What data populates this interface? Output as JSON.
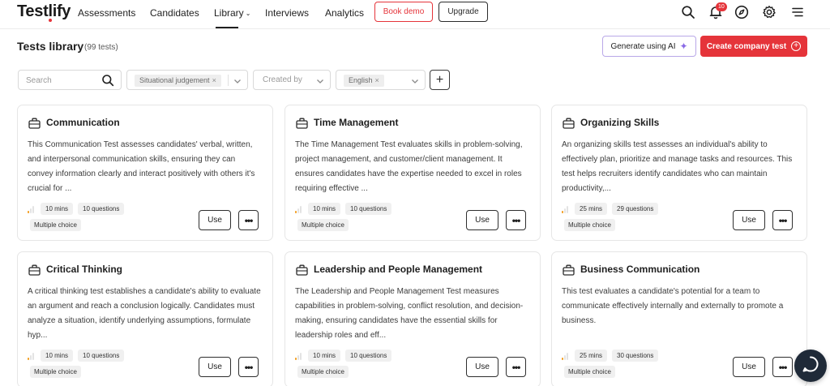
{
  "app": {
    "logo": "Testlify",
    "brand_color": "#e5343a"
  },
  "nav": {
    "links": [
      "Assessments",
      "Candidates",
      "Library",
      "Interviews",
      "Analytics"
    ],
    "active": "Library",
    "book_demo": "Book demo",
    "upgrade": "Upgrade",
    "notifications_count": "10",
    "icons": [
      "search-icon",
      "bell-icon",
      "compass-icon",
      "gear-icon",
      "menu-icon"
    ]
  },
  "header": {
    "title": "Tests library",
    "count": "(99 tests)",
    "ai_button": "Generate using AI",
    "create_button": "Create company test"
  },
  "filters": {
    "search_placeholder": "Search",
    "type_chip": "Situational judgement",
    "created_by_placeholder": "Created by",
    "language_chip": "English"
  },
  "cards": [
    {
      "title": "Communication",
      "description": "This Communication Test assesses candidates' verbal, written, and interpersonal communication skills, ensuring they can convey information clearly and interact positively with others it's crucial for ...",
      "duration": "10 mins",
      "questions": "10 questions",
      "type": "Multiple choice",
      "level": 1,
      "use": "Use"
    },
    {
      "title": "Time Management",
      "description": "The Time Management Test evaluates skills in problem-solving, project management, and customer/client management. It ensures candidates have the expertise needed to excel in roles requiring effective ...",
      "duration": "10 mins",
      "questions": "10 questions",
      "type": "Multiple choice",
      "level": 1,
      "use": "Use"
    },
    {
      "title": "Organizing Skills",
      "description": "An organizing skills test assesses an individual's ability to effectively plan, prioritize and manage tasks and resources. This test helps recruiters identify candidates who can maintain productivity,...",
      "duration": "25 mins",
      "questions": "29 questions",
      "type": "Multiple choice",
      "level": 1,
      "use": "Use"
    },
    {
      "title": "Critical Thinking",
      "description": "A critical thinking test establishes a candidate's ability to evaluate an argument and reach a conclusion logically. Candidates must analyze a situation, identify underlying assumptions, formulate hyp...",
      "duration": "10 mins",
      "questions": "10 questions",
      "type": "Multiple choice",
      "level": 1,
      "use": "Use"
    },
    {
      "title": "Leadership and People Management",
      "description": "The Leadership and People Management Test measures capabilities in problem-solving, conflict resolution, and decision-making, ensuring candidates have the essential skills for leadership roles and eff...",
      "duration": "10 mins",
      "questions": "10 questions",
      "type": "Multiple choice",
      "level": 1,
      "use": "Use"
    },
    {
      "title": "Business Communication",
      "description": "This test evaluates a candidate's potential for a team to communicate effectively internally and externally to promote a business.",
      "duration": "25 mins",
      "questions": "30 questions",
      "type": "Multiple choice",
      "level": 1,
      "use": "Use"
    }
  ]
}
